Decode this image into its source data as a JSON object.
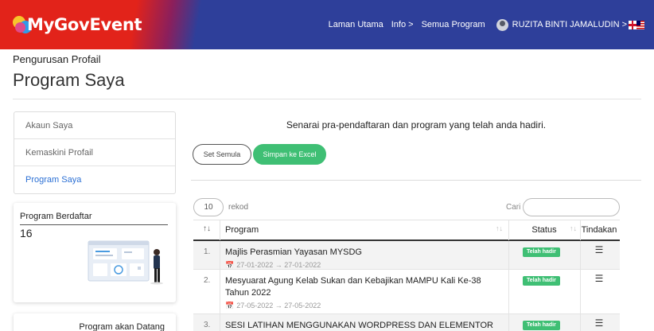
{
  "header": {
    "brand": "MyGovEvent",
    "nav": [
      "Laman Utama",
      "Info >",
      "Semua Program"
    ],
    "user": "RUZITA BINTI JAMALUDIN >",
    "icons": [
      "avatar-icon",
      "language-flag-icon"
    ]
  },
  "page": {
    "subtitle": "Pengurusan Profail",
    "title": "Program Saya"
  },
  "sidebar": {
    "items": [
      {
        "label": "Akaun Saya",
        "active": false
      },
      {
        "label": "Kemaskini Profail",
        "active": false
      },
      {
        "label": "Program Saya",
        "active": true
      }
    ],
    "registered": {
      "label": "Program Berdaftar",
      "count": "16"
    },
    "upcoming": {
      "label": "Program akan Datang"
    }
  },
  "main": {
    "heading": "Senarai pra-pendaftaran dan program yang telah anda hadiri.",
    "reset_label": "Set Semula",
    "excel_label": "Simpan ke Excel",
    "length_value": "10",
    "length_label": "rekod",
    "search_label": "Cari",
    "search_value": ""
  },
  "table": {
    "columns": {
      "program": "Program",
      "status": "Status",
      "action": "Tindakan"
    },
    "rows": [
      {
        "num": "1.",
        "title": "Majlis Perasmian Yayasan MYSDG",
        "date": "27-01-2022 → 27-01-2022",
        "status": "Telah hadir"
      },
      {
        "num": "2.",
        "title": "Mesyuarat Agung Kelab Sukan dan Kebajikan MAMPU Kali Ke-38 Tahun 2022",
        "date": "27-05-2022 → 27-05-2022",
        "status": "Telah hadir"
      },
      {
        "num": "3.",
        "title": "SESI LATIHAN MENGGUNAKAN WORDPRESS DAN ELEMENTOR",
        "date": "",
        "status": "Telah hadir"
      }
    ]
  },
  "colors": {
    "header_red": "#e2231a",
    "header_blue": "#2e3f9a",
    "accent_green": "#3fbf74",
    "link_blue": "#2a6fd4"
  }
}
